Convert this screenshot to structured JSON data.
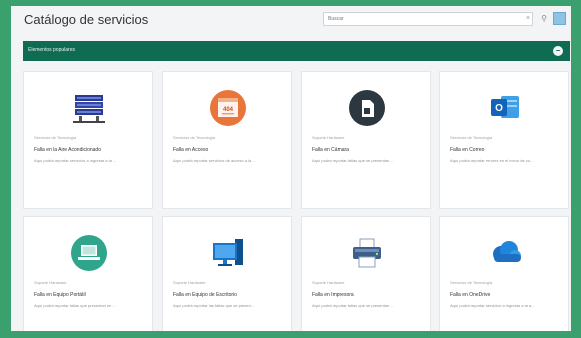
{
  "header": {
    "title": "Catálogo de servicios",
    "search_placeholder": "Buscar",
    "clear_glyph": "×",
    "filter_glyph": "⚲"
  },
  "section": {
    "label": "Elementos populares",
    "collapse_glyph": "−"
  },
  "cards": [
    {
      "icon": "server-rack-icon",
      "category": "Servicios de Tecnología",
      "title": "Falla en la Aire Acondicionado",
      "description": "Aquí podrá reportar servicios a ingresar a la ..."
    },
    {
      "icon": "error-window-icon",
      "category": "Servicios de Tecnología",
      "title": "Falla en Acceso",
      "description": "Aquí podrá reportar servicios de acceso a la ..."
    },
    {
      "icon": "sim-card-icon",
      "category": "Soporte Hardware",
      "title": "Falla en Cámara",
      "description": "Aquí podrá reportar fallas que se presentan ..."
    },
    {
      "icon": "outlook-icon",
      "category": "Servicios de Tecnología",
      "title": "Falla en Correo",
      "description": "Aquí podrá reportar errores en el envío de co..."
    },
    {
      "icon": "laptop-icon",
      "category": "Soporte Hardware",
      "title": "Falla en Equipo Portátil",
      "description": "Aquí podrá reportar fallas que presentan en ..."
    },
    {
      "icon": "desktop-computer-icon",
      "category": "Soporte Hardware",
      "title": "Falla en Equipo de Escritorio",
      "description": "Aquí podrá reportar las fallas que se presen..."
    },
    {
      "icon": "printer-icon",
      "category": "Soporte Hardware",
      "title": "Falla en Impresora",
      "description": "Aquí podrá reportar fallas que se presentan ..."
    },
    {
      "icon": "cloud-icon",
      "category": "Servicios de Tecnología",
      "title": "Falla en OneDrive",
      "description": "Aquí podrá reportar servicios a ingresar a la a..."
    }
  ],
  "colors": {
    "frame": "#3aa06d",
    "section_bar": "#0f6b52",
    "accent_blue": "#1e6fc2",
    "orange": "#e8763a",
    "teal": "#2fa58b"
  }
}
